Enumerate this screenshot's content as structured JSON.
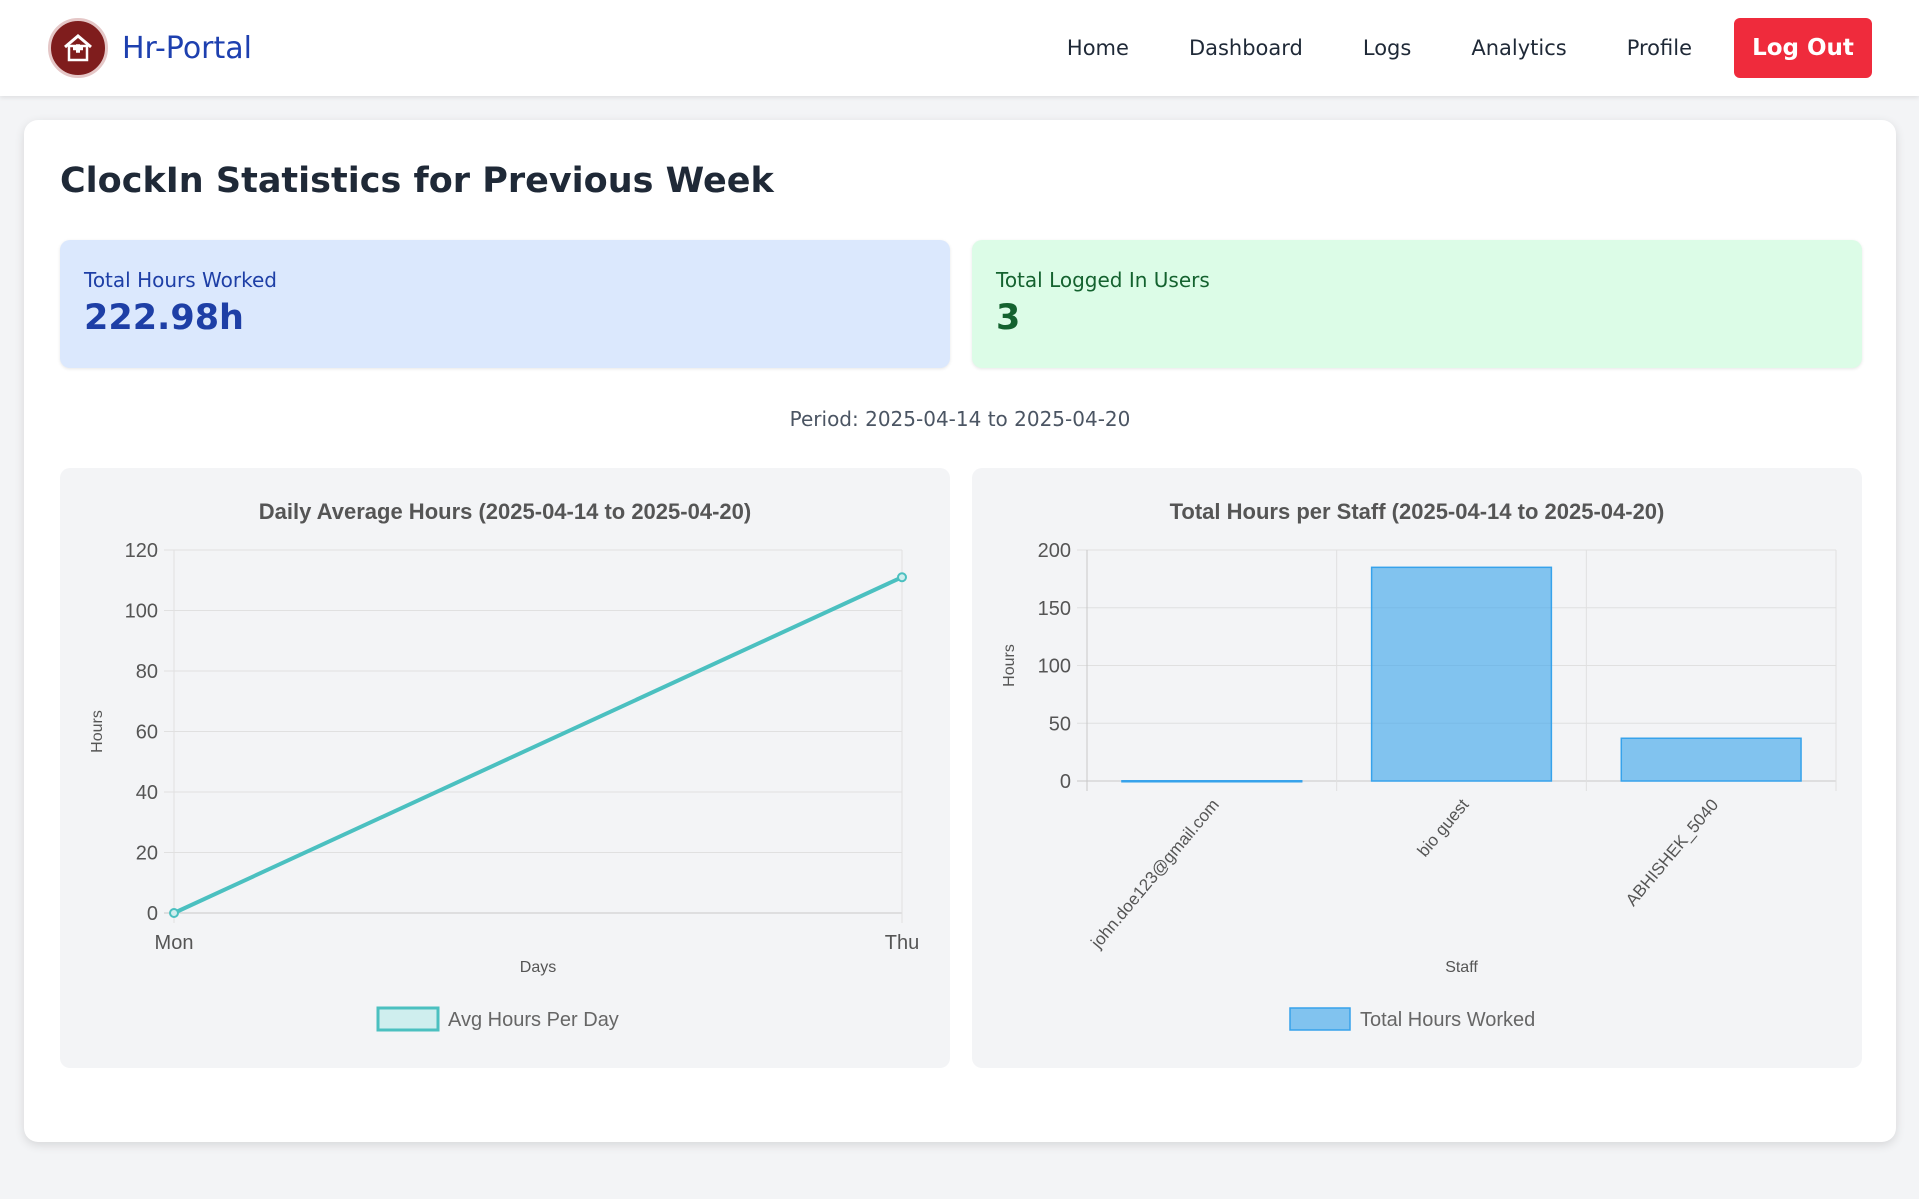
{
  "header": {
    "brand": "Hr-Portal",
    "logo_icon": "hospital-house-icon",
    "nav": [
      "Home",
      "Dashboard",
      "Logs",
      "Analytics",
      "Profile"
    ],
    "logout_label": "Log Out",
    "colors": {
      "brand": "#1e40af",
      "logout": "#ef2b3c"
    }
  },
  "main": {
    "title": "ClockIn Statistics for Previous Week",
    "stats": {
      "hours_label": "Total Hours Worked",
      "hours_value": "222.98h",
      "users_label": "Total Logged In Users",
      "users_value": "3"
    },
    "period": "Period: 2025-04-14 to 2025-04-20"
  },
  "chart_data": [
    {
      "type": "line",
      "title": "Daily Average Hours (2025-04-14 to 2025-04-20)",
      "xlabel": "Days",
      "ylabel": "Hours",
      "categories": [
        "Mon",
        "Thu"
      ],
      "series": [
        {
          "name": "Avg Hours Per Day",
          "values": [
            0,
            111
          ]
        }
      ],
      "ylim": [
        0,
        120
      ],
      "yticks": [
        "0",
        "20",
        "40",
        "60",
        "80",
        "100",
        "120"
      ],
      "color": "#4bc0c0",
      "grid": true,
      "legend": "bottom"
    },
    {
      "type": "bar",
      "title": "Total Hours per Staff (2025-04-14 to 2025-04-20)",
      "xlabel": "Staff",
      "ylabel": "Hours",
      "categories": [
        "john.doe123@gmail.com",
        "bio guest",
        "ABHISHEK_5040"
      ],
      "series": [
        {
          "name": "Total Hours Worked",
          "values": [
            0.2,
            185,
            37
          ]
        }
      ],
      "ylim": [
        0,
        200
      ],
      "yticks": [
        "0",
        "50",
        "100",
        "150",
        "200"
      ],
      "color": "#36a2eb",
      "grid": true,
      "legend": "bottom"
    }
  ]
}
